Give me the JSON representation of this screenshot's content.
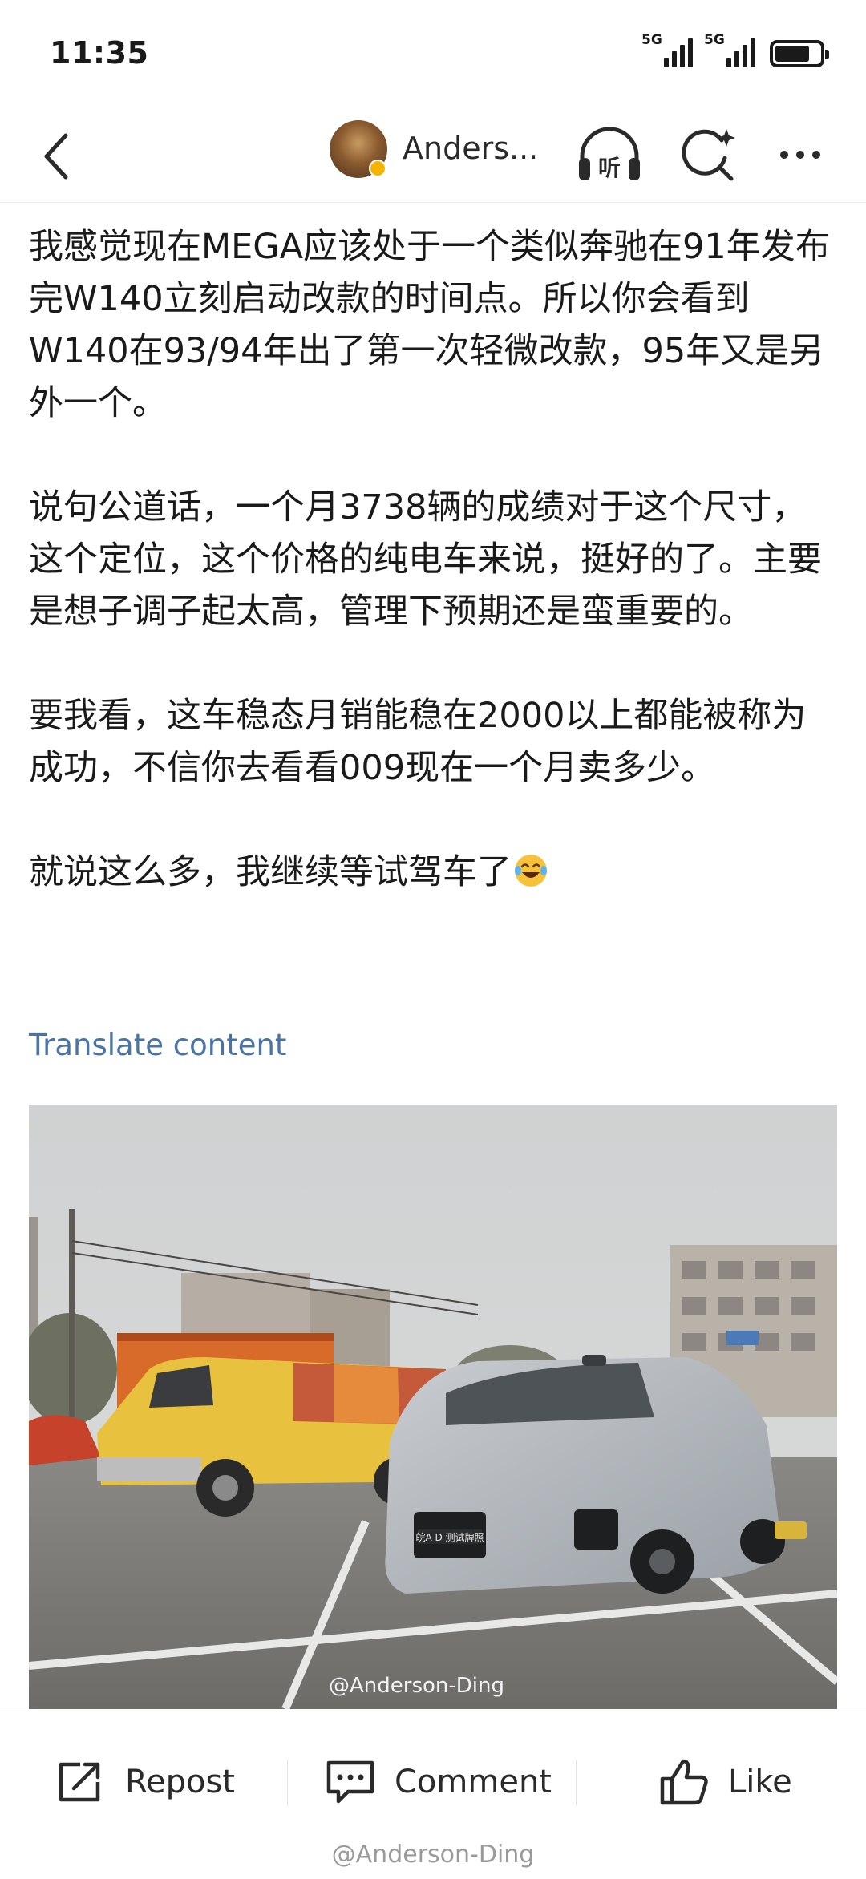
{
  "status_bar": {
    "time": "11:35",
    "signal1_label": "5G",
    "signal2_label": "5G"
  },
  "header": {
    "author_name": "Anders...",
    "listen_label": "听"
  },
  "post": {
    "paragraphs": [
      "我感觉现在MEGA应该处于一个类似奔驰在91年发布完W140立刻启动改款的时间点。所以你会看到W140在93/94年出了第一次轻微改款，95年又是另外一个。",
      "说句公道话，一个月3738辆的成绩对于这个尺寸，这个定位，这个价格的纯电车来说，挺好的了。主要是想子调子起太高，管理下预期还是蛮重要的。",
      "要我看，这车稳态月销能稳在2000以上都能被称为成功，不信你去看看009现在一个月卖多少。",
      "就说这么多，我继续等试驾车了"
    ],
    "translate_label": "Translate content",
    "image_watermark": "@Anderson-Ding",
    "image_license_plate": "皖A D 测试牌照"
  },
  "actions": {
    "repost_label": "Repost",
    "comment_label": "Comment",
    "like_label": "Like"
  },
  "footer_watermark": "@Anderson-Ding",
  "colors": {
    "link": "#4a74a6",
    "verified_badge": "#f5b400",
    "text": "#1a1a1a"
  }
}
